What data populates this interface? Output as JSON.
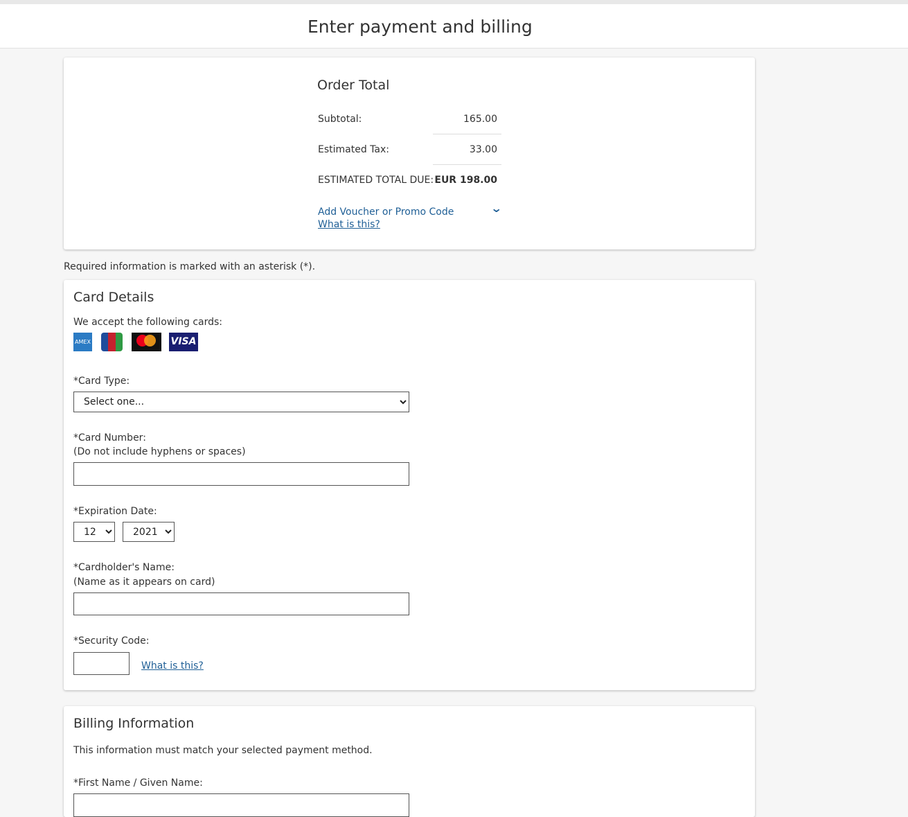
{
  "header": {
    "title": "Enter payment and billing"
  },
  "order": {
    "title": "Order Total",
    "subtotal_label": "Subtotal:",
    "subtotal": "165.00",
    "tax_label": "Estimated Tax:",
    "tax": "33.00",
    "total_label": "ESTIMATED TOTAL DUE:",
    "total": "EUR 198.00",
    "voucher_link": "Add Voucher or Promo Code",
    "voucher_help": "What is this?"
  },
  "required_note": "Required information is marked with an asterisk (*).",
  "card_details": {
    "title": "Card Details",
    "accept_text": "We accept the following cards:",
    "logos": [
      "AMEX",
      "JCB",
      "mastercard",
      "VISA"
    ],
    "card_type_label": "*Card Type:",
    "card_type_value": "Select one...",
    "card_number_label": "*Card Number:",
    "card_number_hint": "(Do not include hyphens or spaces)",
    "expiration_label": "*Expiration Date:",
    "exp_month": "12",
    "exp_year": "2021",
    "name_label": "*Cardholder's Name:",
    "name_hint": "(Name as it appears on card)",
    "security_label": "*Security Code:",
    "security_help": "What is this?"
  },
  "billing": {
    "title": "Billing Information",
    "note": "This information must match your selected payment method.",
    "first_name_label": "*First Name / Given Name:"
  }
}
